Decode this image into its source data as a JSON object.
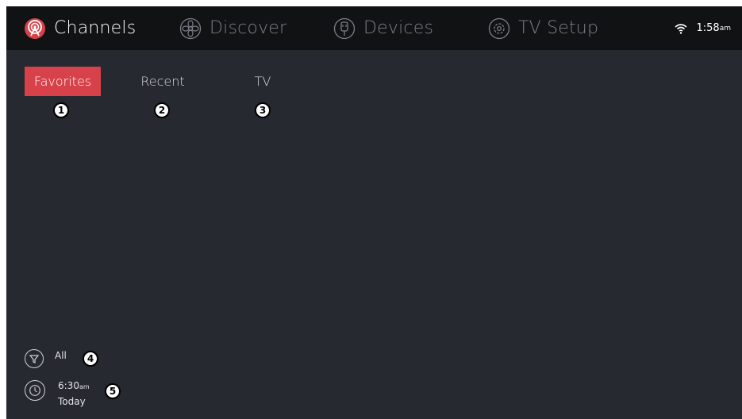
{
  "nav": {
    "items": [
      {
        "label": "Channels",
        "icon": "channels-broadcast-icon",
        "active": true
      },
      {
        "label": "Discover",
        "icon": "discover-flower-icon",
        "active": false
      },
      {
        "label": "Devices",
        "icon": "devices-plug-icon",
        "active": false
      },
      {
        "label": "TV Setup",
        "icon": "tv-setup-gear-icon",
        "active": false
      }
    ],
    "accent_color": "#d7414a"
  },
  "status": {
    "wifi_icon": "wifi-icon",
    "time": "1:58",
    "ampm": "am"
  },
  "tabs": [
    {
      "label": "Favorites",
      "selected": true
    },
    {
      "label": "Recent",
      "selected": false
    },
    {
      "label": "TV",
      "selected": false
    }
  ],
  "markers": [
    "1",
    "2",
    "3",
    "4",
    "5"
  ],
  "filter": {
    "icon": "funnel-filter-icon",
    "label": "All"
  },
  "schedule": {
    "icon": "clock-icon",
    "time": "6:30",
    "ampm": "am",
    "day": "Today"
  }
}
